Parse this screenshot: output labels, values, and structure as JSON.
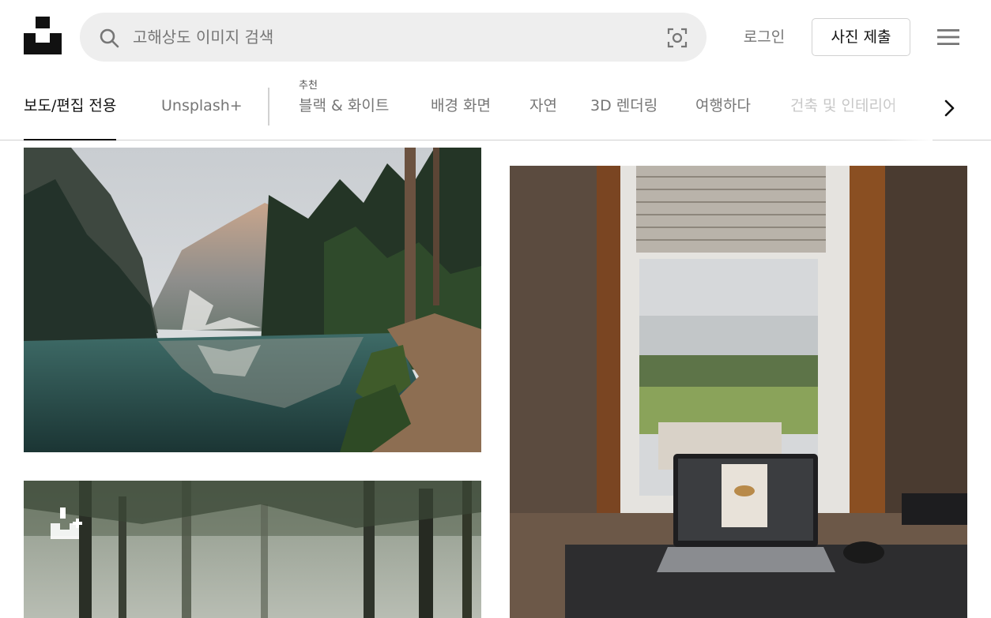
{
  "header": {
    "logo_icon": "unsplash-logo-icon",
    "search": {
      "placeholder": "고해상도 이미지 검색",
      "value": "",
      "icon": "search-icon",
      "visual_search_icon": "visual-search-icon"
    },
    "login_label": "로그인",
    "submit_label": "사진 제출",
    "menu_icon": "hamburger-menu-icon"
  },
  "nav": {
    "primary_tabs": [
      {
        "label": "보도/편집 전용",
        "active": true
      },
      {
        "label": "Unsplash+",
        "active": false
      }
    ],
    "featured_label": "추천",
    "topics": [
      "블랙 & 화이트",
      "배경 화면",
      "자연",
      "3D 렌더링",
      "여행하다",
      "건축 및 인테리어"
    ],
    "next_icon": "chevron-right-icon"
  },
  "photos": [
    {
      "subject": "mountain lake with forest reflection"
    },
    {
      "subject": "misty forest"
    },
    {
      "subject": "laptop on desk by window"
    }
  ],
  "overlay_icon": "unsplash-plus-icon",
  "colors": {
    "accent_text": "#111111",
    "muted_text": "#767676",
    "search_background": "#eeeeee",
    "border": "#d1d1d1"
  }
}
